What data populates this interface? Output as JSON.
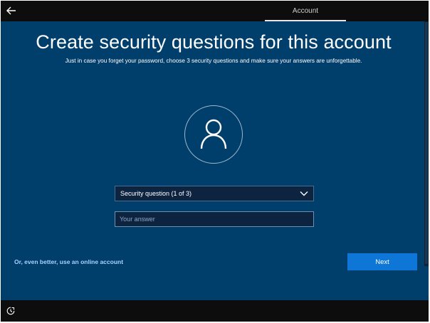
{
  "header": {
    "back_label": "Back",
    "tab_label": "Account"
  },
  "main": {
    "title": "Create security questions for this account",
    "subtitle": "Just in case you forget your password, choose 3 security questions and make sure your answers are unforgettable.",
    "avatar_icon": "user-avatar-icon",
    "security_question": {
      "selected": "Security question (1 of 3)",
      "icon": "chevron-down-icon"
    },
    "answer": {
      "value": "",
      "placeholder": "Your answer"
    }
  },
  "footer": {
    "online_account_link": "Or, even better, use an online account",
    "next_label": "Next",
    "ease_of_access_icon": "ease-of-access-icon"
  },
  "colors": {
    "background": "#003e6c",
    "accent_button": "#0e76d6",
    "link": "#a9d4ff",
    "bars": "#0d0d0d"
  }
}
